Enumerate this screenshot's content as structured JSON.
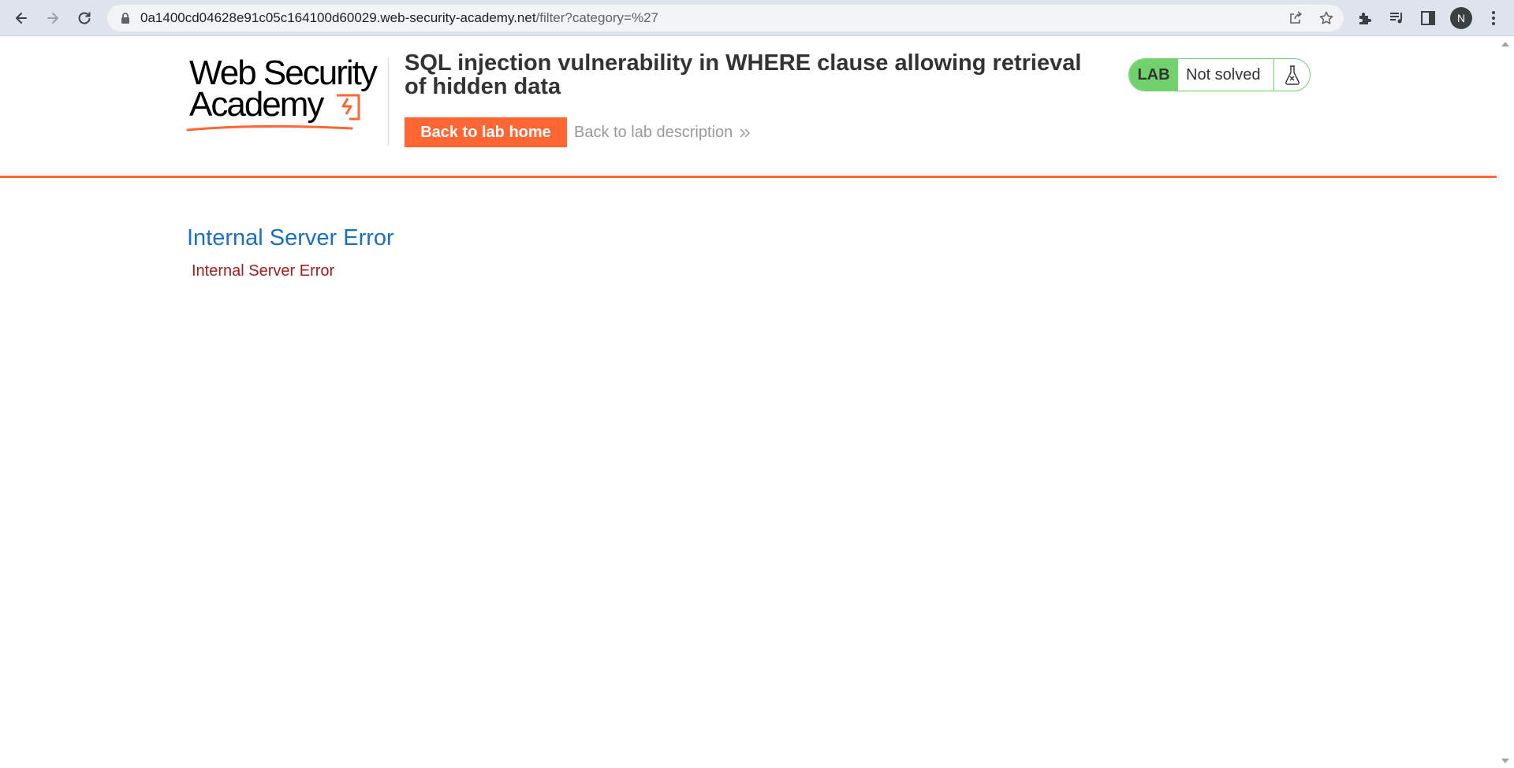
{
  "browser": {
    "url_host": "0a1400cd04628e91c05c164100d60029.web-security-academy.net",
    "url_path": "/filter?category=%27",
    "profile_initial": "N",
    "icons": [
      "back-arrow-icon",
      "forward-arrow-icon",
      "reload-icon",
      "lock-icon",
      "share-icon",
      "star-icon",
      "extensions-icon",
      "media-icon",
      "side-panel-icon",
      "menu-icon"
    ]
  },
  "header": {
    "logo_line1": "Web Security",
    "logo_line2": "Academy",
    "lab_title": "SQL injection vulnerability in WHERE clause allowing retrieval of hidden data",
    "back_home_label": "Back to lab home",
    "back_description_label": "Back to lab description",
    "lab_badge": "LAB",
    "lab_status": "Not solved"
  },
  "content": {
    "heading": "Internal Server Error",
    "message": "Internal Server Error"
  },
  "colors": {
    "accent": "#ff6633",
    "lab_green": "#70d16d",
    "heading_blue": "#1c6fc2",
    "error_red": "#a21c1c"
  }
}
